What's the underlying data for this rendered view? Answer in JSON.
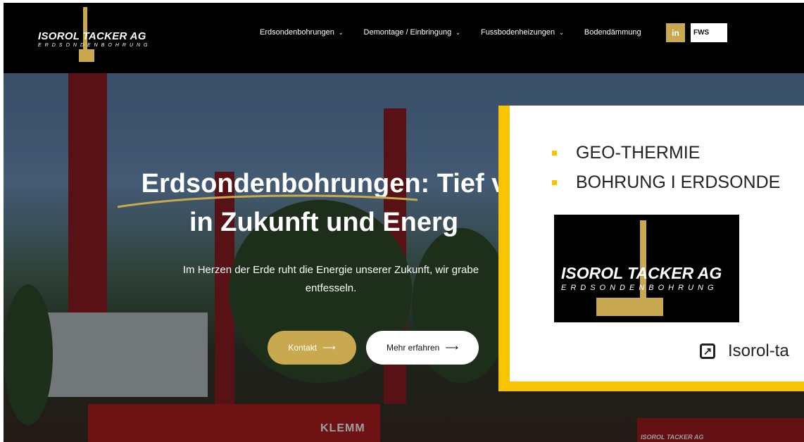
{
  "brand": {
    "name": "ISOROL TACKER AG",
    "tagline": "ERDSONDENBOHRUNG"
  },
  "nav": {
    "items": [
      {
        "label": "Erdsondenbohrungen",
        "dropdown": true
      },
      {
        "label": "Demontage / Einbringung",
        "dropdown": true
      },
      {
        "label": "Fussbodenheizungen",
        "dropdown": true
      },
      {
        "label": "Bodendämmung",
        "dropdown": false
      }
    ],
    "linkedin": "in",
    "fws": "FWS"
  },
  "hero": {
    "title_line1": "Erdsondenbohrungen: Tief v",
    "title_line2": "in Zukunft und Energ",
    "subtitle_line1": "Im Herzen der Erde ruht die Energie unserer Zukunft, wir grabe",
    "subtitle_line2": "entfesseln.",
    "contact_button": "Kontakt",
    "more_button": "Mehr erfahren",
    "machine_label": "KLEMM",
    "machine2_label": "ISOROL TACKER AG"
  },
  "card": {
    "bullets": [
      "GEO-THERMIE",
      "BOHRUNG I ERDSONDE"
    ],
    "logo_name": "ISOROL TACKER AG",
    "logo_tagline": "ERDSONDENBOHRUNG",
    "link_text": "Isorol-ta"
  },
  "colors": {
    "gold": "#c8a94f",
    "yellow": "#f6c400",
    "header": "#000000"
  },
  "icons": {
    "chevron": "chevron-down-icon",
    "arrow": "arrow-right-icon",
    "external": "external-link-icon"
  }
}
